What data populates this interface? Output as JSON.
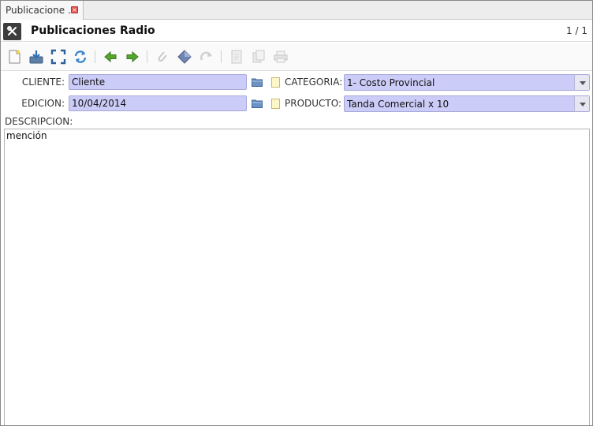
{
  "tab": {
    "label": "Publicacione ..."
  },
  "header": {
    "title": "Publicaciones Radio",
    "pager": "1 / 1"
  },
  "form": {
    "cliente": {
      "label": "CLIENTE:",
      "value": "Cliente"
    },
    "edicion": {
      "label": "EDICION:",
      "value": "10/04/2014"
    },
    "categoria": {
      "label": "CATEGORIA:",
      "value": "1- Costo Provincial"
    },
    "producto": {
      "label": "PRODUCTO:",
      "value": "Tanda Comercial x 10"
    },
    "descripcion": {
      "label": "DESCRIPCION:",
      "value": "mención"
    }
  },
  "colors": {
    "field_bg": "#ccccf8",
    "field_border": "#a8a8d8",
    "header_badge": "#3d3d3d"
  },
  "toolbar_icons": [
    "new-icon",
    "save-icon",
    "fullscreen-icon",
    "refresh-icon",
    "arrow-left-icon",
    "arrow-right-icon",
    "attach-icon",
    "diamond-icon",
    "redo-icon",
    "report-icon",
    "copy-icon",
    "print-icon"
  ]
}
